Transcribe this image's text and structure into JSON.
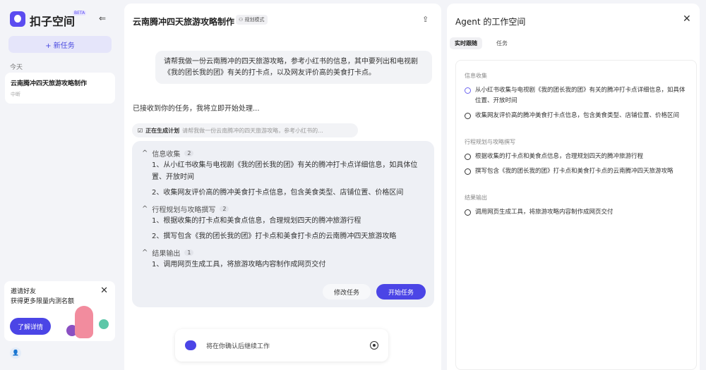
{
  "sidebar": {
    "brand": "扣子空间",
    "beta": "BETA",
    "new_task": "+ 新任务",
    "today": "今天",
    "task": {
      "title": "云南腾冲四天旅游攻略制作",
      "status": "中断"
    },
    "invite": {
      "line1": "邀请好友",
      "line2": "获得更多限量内测名额",
      "button": "了解详情"
    }
  },
  "main": {
    "title": "云南腾冲四天旅游攻略制作",
    "mode": "规划模式",
    "user_message": "请帮我做一份云南腾冲的四天旅游攻略，参考小红书的信息，其中要列出和电视剧《我的团长我的团》有关的打卡点，以及网友评价高的美食打卡点。",
    "received": "已接收到你的任务，我将立即开始处理...",
    "chip": {
      "label": "正在生成计划",
      "preview": "请帮我做一份云南腾冲的四天旅游攻略，参考小红书的..."
    },
    "plan": [
      {
        "title": "信息收集",
        "count": "2",
        "items": [
          "1、从小红书收集与电视剧《我的团长我的团》有关的腾冲打卡点详细信息，如具体位置、开放时间",
          "2、收集网友评价高的腾冲美食打卡点信息，包含美食类型、店铺位置、价格区间"
        ]
      },
      {
        "title": "行程规划与攻略撰写",
        "count": "2",
        "items": [
          "1、根据收集的打卡点和美食点信息，合理规划四天的腾冲旅游行程",
          "2、撰写包含《我的团长我的团》打卡点和美食打卡点的云南腾冲四天旅游攻略"
        ]
      },
      {
        "title": "结果输出",
        "count": "1",
        "items": [
          "1、调用网页生成工具，将旅游攻略内容制作成网页交付"
        ]
      }
    ],
    "modify": "修改任务",
    "start": "开始任务",
    "input_status": "将在你确认后继续工作"
  },
  "right": {
    "title": "Agent 的工作空间",
    "tabs": [
      "实时跟随",
      "任务"
    ],
    "sections": [
      {
        "title": "信息收集",
        "items": [
          "从小红书收集与电视剧《我的团长我的团》有关的腾冲打卡点详细信息，如具体位置、开放时间",
          "收集网友评价高的腾冲美食打卡点信息，包含美食类型、店铺位置、价格区间"
        ]
      },
      {
        "title": "行程规划与攻略撰写",
        "items": [
          "根据收集的打卡点和美食点信息，合理规划四天的腾冲旅游行程",
          "撰写包含《我的团长我的团》打卡点和美食打卡点的云南腾冲四天旅游攻略"
        ]
      },
      {
        "title": "结果输出",
        "items": [
          "调用网页生成工具，将旅游攻略内容制作成网页交付"
        ]
      }
    ]
  }
}
